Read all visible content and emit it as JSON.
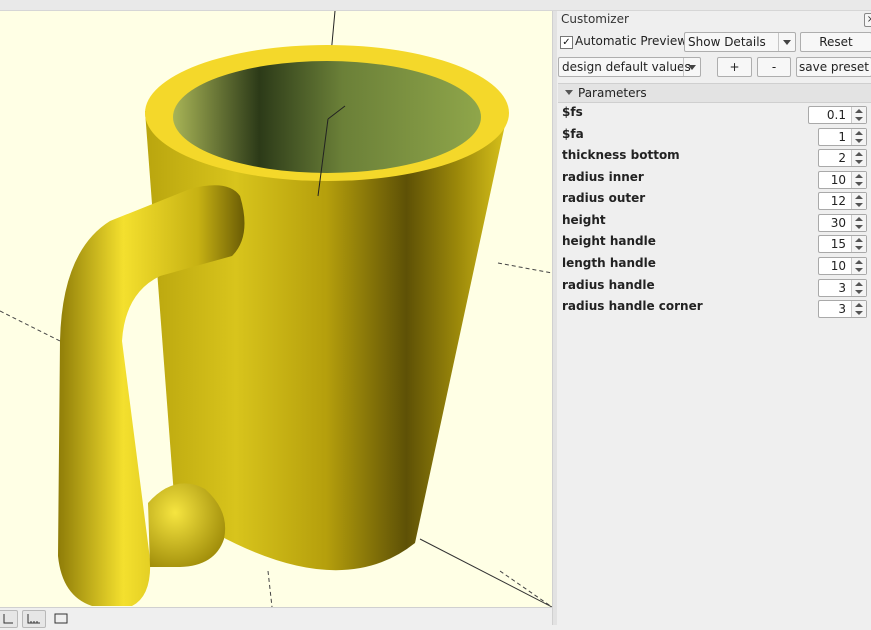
{
  "customizer": {
    "title": "Customizer",
    "close_icon": "close-icon",
    "automatic_preview": {
      "label": "Automatic Preview",
      "checked": true
    },
    "details_select": "Show Details",
    "reset_label": "Reset",
    "preset_select": "design default values",
    "add_label": "+",
    "remove_label": "-",
    "save_preset_label": "save preset",
    "section_label": "Parameters",
    "params": [
      {
        "name": "$fs",
        "value": "0.1"
      },
      {
        "name": "$fa",
        "value": "1"
      },
      {
        "name": "thickness bottom",
        "value": "2"
      },
      {
        "name": "radius inner",
        "value": "10"
      },
      {
        "name": "radius outer",
        "value": "12"
      },
      {
        "name": "height",
        "value": "30"
      },
      {
        "name": "height handle",
        "value": "15"
      },
      {
        "name": "length handle",
        "value": "10"
      },
      {
        "name": "radius handle",
        "value": "3"
      },
      {
        "name": "radius handle corner",
        "value": "3"
      }
    ]
  },
  "viewport": {
    "background": "#ffffe5",
    "model_color": "#f2dc2a",
    "inner_color": "#7f9a3e"
  },
  "bottom_toolbar": {
    "icons": [
      "axes-icon",
      "scale-markers-icon",
      "edges-icon"
    ]
  }
}
